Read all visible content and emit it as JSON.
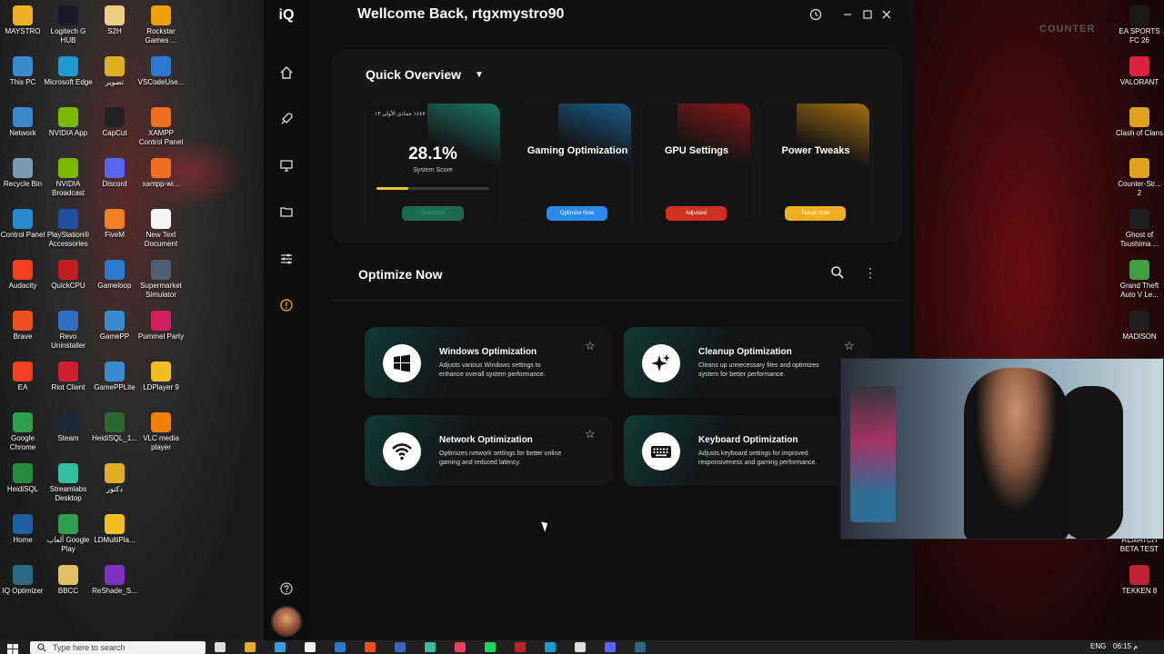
{
  "desktop": {
    "left_icons": [
      {
        "label": "MAYSTRO",
        "color": "#f0b020"
      },
      {
        "label": "Logitech G HUB",
        "color": "#1a1a2a"
      },
      {
        "label": "S2H",
        "color": "#e8d080"
      },
      {
        "label": "Rockstar Games ...",
        "color": "#f0a000"
      },
      {
        "label": "This PC",
        "color": "#3a8ad0"
      },
      {
        "label": "Microsoft Edge",
        "color": "#1e9ad0"
      },
      {
        "label": "تصوير",
        "color": "#e0b020"
      },
      {
        "label": "VSCodeUse...",
        "color": "#2a7ad0"
      },
      {
        "label": "Network",
        "color": "#3a8ad0"
      },
      {
        "label": "NVIDIA App",
        "color": "#76b900"
      },
      {
        "label": "CapCut",
        "color": "#222222"
      },
      {
        "label": "XAMPP Control Panel",
        "color": "#f07020"
      },
      {
        "label": "Recycle Bin",
        "color": "#7a9ab0"
      },
      {
        "label": "NVIDIA Broadcast",
        "color": "#76b900"
      },
      {
        "label": "Discord",
        "color": "#5865f2"
      },
      {
        "label": "xampp-wi...",
        "color": "#f07020"
      },
      {
        "label": "Control Panel",
        "color": "#2a8ad0"
      },
      {
        "label": "PlayStation® Accessories",
        "color": "#2050a0"
      },
      {
        "label": "FiveM",
        "color": "#f08020"
      },
      {
        "label": "New Text Document",
        "color": "#f5f5f5"
      },
      {
        "label": "Audacity",
        "color": "#f04020"
      },
      {
        "label": "QuickCPU",
        "color": "#c02020"
      },
      {
        "label": "Gameloop",
        "color": "#2a7ad0"
      },
      {
        "label": "Supermarket Simulator",
        "color": "#506070"
      },
      {
        "label": "Brave",
        "color": "#f05020"
      },
      {
        "label": "Revo Uninstaller",
        "color": "#3070c0"
      },
      {
        "label": "GamePP",
        "color": "#3a8ad0"
      },
      {
        "label": "Pummel Party",
        "color": "#d02060"
      },
      {
        "label": "EA",
        "color": "#f04020"
      },
      {
        "label": "Riot Client",
        "color": "#d02030"
      },
      {
        "label": "GamePPLite",
        "color": "#3a8ad0"
      },
      {
        "label": "LDPlayer 9",
        "color": "#f0c020"
      },
      {
        "label": "Google Chrome",
        "color": "#30a050"
      },
      {
        "label": "Steam",
        "color": "#1b2838"
      },
      {
        "label": "HeidiSQL_1...",
        "color": "#2a6a30"
      },
      {
        "label": "VLC media player",
        "color": "#f08000"
      },
      {
        "label": "HeidiSQL",
        "color": "#2a8a40"
      },
      {
        "label": "Streamlabs Desktop",
        "color": "#30c0a0"
      },
      {
        "label": "دكتور",
        "color": "#e0b020"
      },
      {
        "label": "",
        "color": "transparent"
      },
      {
        "label": "Home",
        "color": "#2060a0"
      },
      {
        "label": "ألعاب Google Play",
        "color": "#30a050"
      },
      {
        "label": "LDMultiPla...",
        "color": "#f0c020"
      },
      {
        "label": "",
        "color": "transparent"
      },
      {
        "label": "IQ Optimizer",
        "color": "#2a6a80"
      },
      {
        "label": "BBCC",
        "color": "#e0c060"
      },
      {
        "label": "ReShade_S...",
        "color": "#8030c0"
      }
    ],
    "right_icons": [
      {
        "label": "EA SPORTS FC 26",
        "color": "#1a1a1a"
      },
      {
        "label": "VALORANT",
        "color": "#e02040"
      },
      {
        "label": "Clash of Clans",
        "color": "#e0a020"
      },
      {
        "label": "Counter-Str... 2",
        "color": "#e0a020"
      },
      {
        "label": "Ghost of Tsushima ...",
        "color": "#202020"
      },
      {
        "label": "Grand Theft Auto V Le...",
        "color": "#40a040"
      },
      {
        "label": "MADISON",
        "color": "#202020"
      },
      {
        "label": "REMATCH BETA TEST",
        "color": "#202020"
      },
      {
        "label": "TEKKEN 8",
        "color": "#c02030"
      }
    ],
    "watermark": "COUNTER"
  },
  "app": {
    "logo": "iQ",
    "welcome": "Wellcome Back, rtgxmystro90",
    "sidebar_icons": [
      "home-icon",
      "rocket-icon",
      "monitor-icon",
      "folder-icon",
      "sliders-icon",
      "alert-icon"
    ],
    "overview": {
      "title": "Quick Overview",
      "score": {
        "date": "١٤٤٧ جمادى الأولى ١٣",
        "value": "28.1%",
        "label": "System Score",
        "progress": 0.281,
        "button": "Optimized"
      },
      "cards": [
        {
          "title": "Gaming Optimization",
          "button": "Optimize Now",
          "glow": "#1a6aa0",
          "btn_color": "#2a8af0"
        },
        {
          "title": "GPU Settings",
          "button": "Adjusted",
          "glow": "#a01818",
          "btn_color": "#d03020"
        },
        {
          "title": "Power Tweaks",
          "button": "Tweak Now",
          "glow": "#c08010",
          "btn_color": "#f0b020"
        }
      ]
    },
    "optimize": {
      "title": "Optimize Now",
      "items": [
        {
          "title": "Windows Optimization",
          "desc": "Adjusts various Windows settings to enhance overall system performance.",
          "icon": "windows-icon"
        },
        {
          "title": "Cleanup Optimization",
          "desc": "Cleans up unnecessary files and optimizes system for better performance.",
          "icon": "sparkle-icon"
        },
        {
          "title": "Network Optimization",
          "desc": "Optimizes network settings for better online gaming and reduced latency.",
          "icon": "wifi-icon"
        },
        {
          "title": "Keyboard Optimization",
          "desc": "Adjusts keyboard settings for improved responsiveness and gaming performance.",
          "icon": "keyboard-icon"
        }
      ]
    }
  },
  "taskbar": {
    "search_placeholder": "Type here to search",
    "lang": "ENG",
    "time": "06:15 م"
  }
}
